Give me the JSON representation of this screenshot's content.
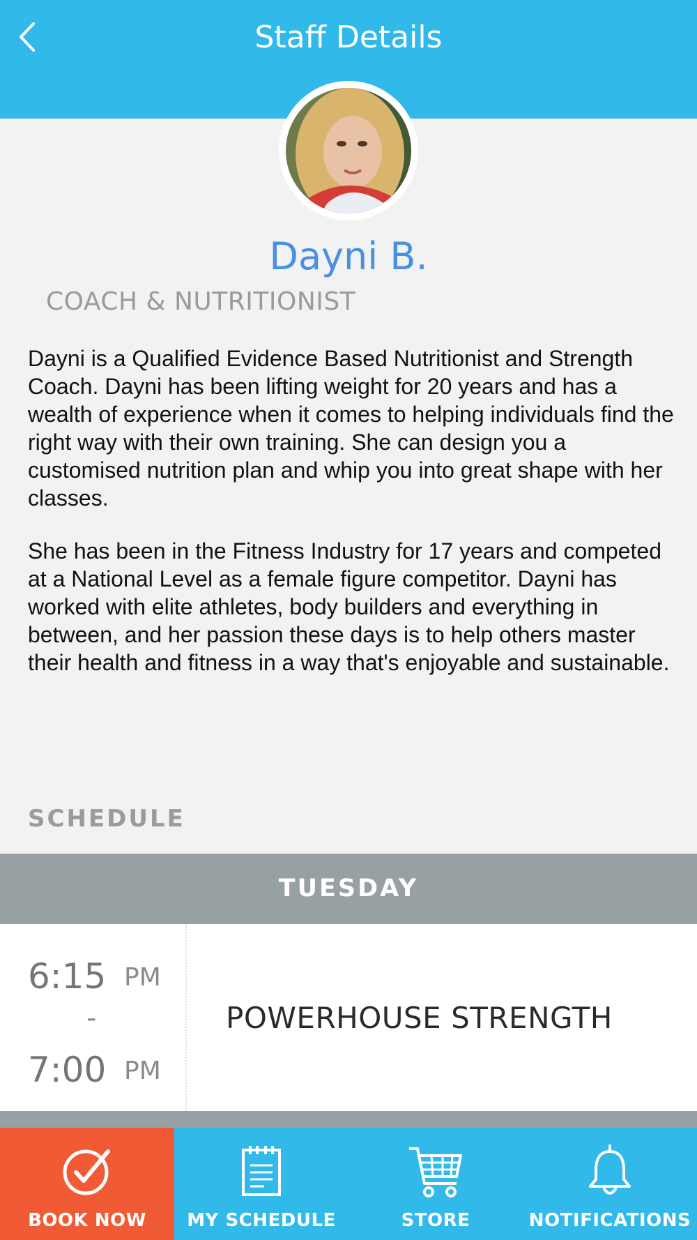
{
  "header": {
    "title": "Staff Details"
  },
  "staff": {
    "name": "Dayni B.",
    "role": "COACH & NUTRITIONIST",
    "bio": [
      "Dayni is a Qualified Evidence Based Nutritionist and Strength Coach. Dayni has been lifting weight for 20 years and has a wealth of experience when it comes to helping individuals find the right way with their own training. She can design you a customised nutrition plan and whip you into great shape with her classes.",
      "She has been in the Fitness Industry for 17 years and competed at a National Level as a female figure competitor. Dayni has worked with elite athletes, body builders and everything in between, and her passion these days is to help others master their health and fitness in a way that's enjoyable and sustainable."
    ]
  },
  "schedule": {
    "label": "SCHEDULE",
    "days": [
      {
        "day": "TUESDAY",
        "classes": [
          {
            "start": "6:15",
            "start_ampm": "PM",
            "separator": "-",
            "end": "7:00",
            "end_ampm": "PM",
            "name": "POWERHOUSE STRENGTH"
          }
        ]
      }
    ]
  },
  "tabbar": {
    "items": [
      {
        "label": "BOOK NOW",
        "icon": "check-circle-icon",
        "active": true
      },
      {
        "label": "MY SCHEDULE",
        "icon": "calendar-icon",
        "active": false
      },
      {
        "label": "STORE",
        "icon": "cart-icon",
        "active": false
      },
      {
        "label": "NOTIFICATIONS",
        "icon": "bell-icon",
        "active": false
      }
    ]
  },
  "colors": {
    "header": "#31b9ea",
    "name": "#4a90e2",
    "day_bar": "#97a0a3",
    "active_tab": "#f05a35"
  }
}
